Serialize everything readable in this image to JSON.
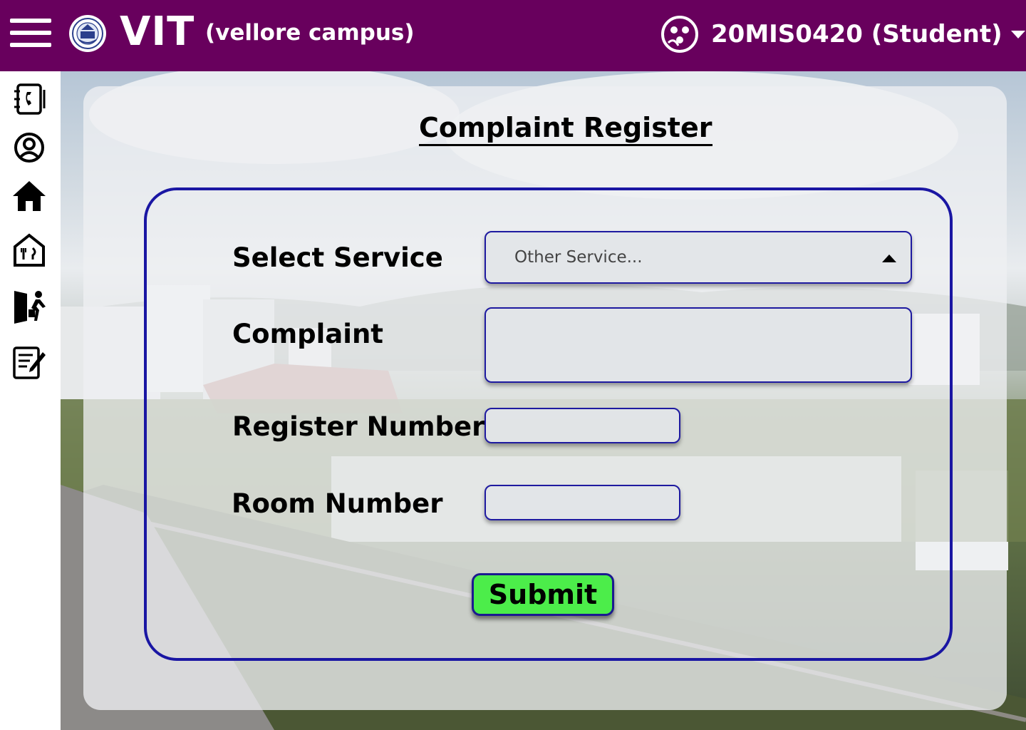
{
  "header": {
    "brand": "VIT",
    "campus": "(vellore campus)",
    "user": "20MIS0420 (Student)",
    "background_color": "#68005d"
  },
  "sidebar": {
    "items": [
      {
        "icon": "contacts-book-icon"
      },
      {
        "icon": "profile-icon"
      },
      {
        "icon": "home-icon"
      },
      {
        "icon": "mess-food-icon"
      },
      {
        "icon": "leave-exit-icon"
      },
      {
        "icon": "complaint-form-icon"
      }
    ]
  },
  "page": {
    "title": "Complaint Register"
  },
  "form": {
    "service_label": "Select Service",
    "service_value": "Other Service...",
    "complaint_label": "Complaint",
    "register_label": "Register Number",
    "room_label": "Room Number",
    "submit_label": "Submit",
    "border_color": "#1a16a3",
    "submit_color": "#4ced4a"
  }
}
